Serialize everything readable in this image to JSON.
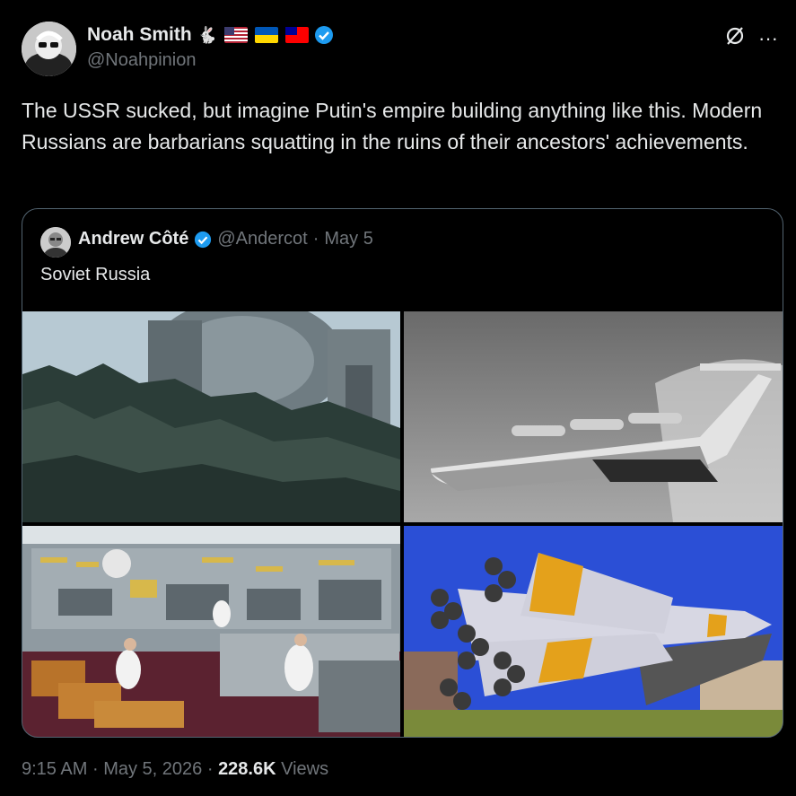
{
  "author": {
    "name": "Noah Smith",
    "handle": "@Noahpinion",
    "name_emoji": "🐇",
    "verified_color": "#1d9bf0"
  },
  "tweet": {
    "text": "The USSR sucked, but imagine Putin's empire building anything like this. Modern Russians are barbarians squatting in the ruins of their ancestors' achievements."
  },
  "quoted": {
    "name": "Andrew Côté",
    "handle": "@Andercot",
    "separator": "·",
    "date": "May 5",
    "text": "Soviet Russia",
    "images": [
      {
        "name": "radio-telescope-image"
      },
      {
        "name": "ekranoplan-image"
      },
      {
        "name": "control-room-image"
      },
      {
        "name": "rocket-image"
      }
    ]
  },
  "footer": {
    "time": "9:15 AM",
    "dot": "·",
    "date": "May 5, 2026",
    "views_count": "228.6K",
    "views_label": "Views"
  },
  "icons": {
    "grok": "grok-icon",
    "more": "more-icon",
    "verified": "verified-badge-icon"
  }
}
